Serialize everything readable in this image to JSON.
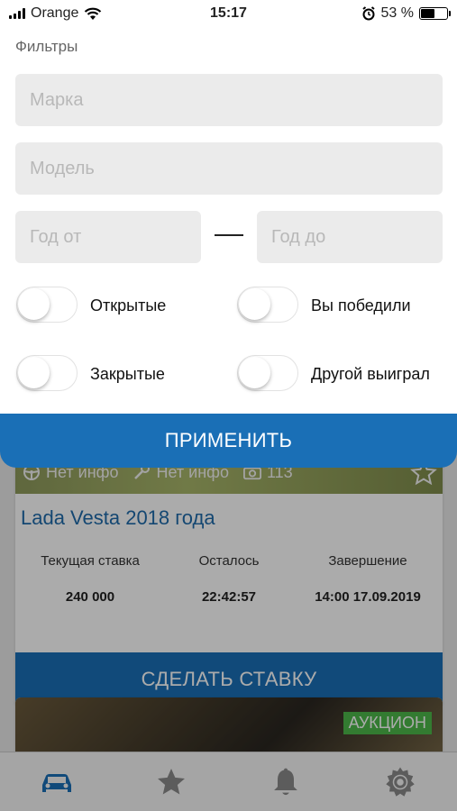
{
  "status_bar": {
    "carrier": "Orange",
    "time": "15:17",
    "battery": "53 %",
    "battery_level": 0.53
  },
  "filters": {
    "title": "Фильтры",
    "make_placeholder": "Марка",
    "model_placeholder": "Модель",
    "year_from_placeholder": "Год от",
    "year_to_placeholder": "Год до",
    "toggles": {
      "open": {
        "label": "Открытые",
        "on": false
      },
      "won": {
        "label": "Вы победили",
        "on": false
      },
      "closed": {
        "label": "Закрытые",
        "on": false
      },
      "other_won": {
        "label": "Другой выиграл",
        "on": false
      }
    },
    "apply_label": "ПРИМЕНИТЬ"
  },
  "listing": {
    "meta_steering": "Нет инфо",
    "meta_engine": "Нет инфо",
    "photo_count": "113",
    "title": "Lada Vesta 2018 года",
    "current_bid_label": "Текущая ставка",
    "current_bid_value": "240 000",
    "remaining_label": "Осталось",
    "remaining_value": "22:42:57",
    "end_label": "Завершение",
    "end_value": "14:00 17.09.2019",
    "bid_button": "СДЕЛАТЬ СТАВКУ",
    "badge": "АУКЦИОН"
  },
  "tabbar": {
    "tabs": [
      {
        "icon": "car-icon",
        "active": true
      },
      {
        "icon": "star-icon",
        "active": false
      },
      {
        "icon": "bell-icon",
        "active": false
      },
      {
        "icon": "gear-icon",
        "active": false
      }
    ]
  },
  "colors": {
    "accent": "#1a6fb6",
    "badge": "#4cb849",
    "title_link": "#1e6aaa"
  }
}
